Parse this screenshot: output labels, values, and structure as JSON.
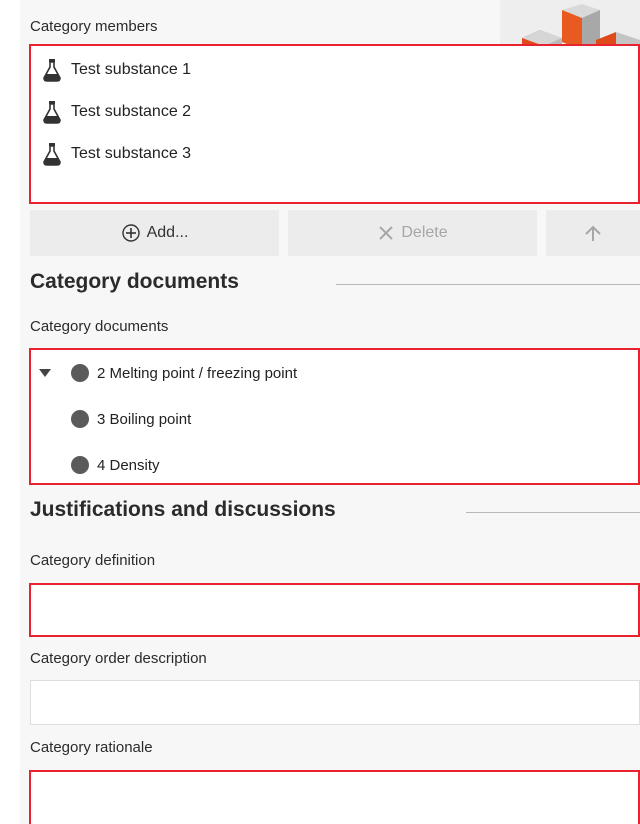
{
  "members": {
    "label": "Category members",
    "items": [
      {
        "name": "Test substance 1"
      },
      {
        "name": "Test substance 2"
      },
      {
        "name": "Test substance 3"
      }
    ]
  },
  "toolbar": {
    "add_label": "Add...",
    "delete_label": "Delete"
  },
  "category_documents": {
    "section_title": "Category documents",
    "label": "Category documents",
    "items": [
      {
        "label": "2 Melting point / freezing point"
      },
      {
        "label": "3 Boiling point"
      },
      {
        "label": "4 Density"
      }
    ]
  },
  "justifications": {
    "section_title": "Justifications and discussions",
    "definition_label": "Category definition",
    "order_label": "Category order description",
    "rationale_label": "Category rationale"
  },
  "colors": {
    "required_border": "#e8232d",
    "panel_bg": "#f7f7f7"
  }
}
